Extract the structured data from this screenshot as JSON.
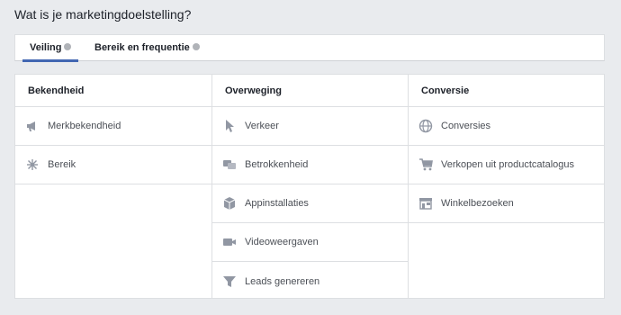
{
  "page": {
    "title": "Wat is je marketingdoelstelling?"
  },
  "tabs": [
    {
      "label": "Veiling",
      "active": true
    },
    {
      "label": "Bereik en frequentie",
      "active": false
    }
  ],
  "columns": [
    {
      "header": "Bekendheid",
      "items": [
        {
          "label": "Merkbekendheid",
          "icon": "megaphone-icon"
        },
        {
          "label": "Bereik",
          "icon": "asterisk-icon"
        }
      ]
    },
    {
      "header": "Overweging",
      "items": [
        {
          "label": "Verkeer",
          "icon": "cursor-icon"
        },
        {
          "label": "Betrokkenheid",
          "icon": "chat-bubbles-icon"
        },
        {
          "label": "Appinstallaties",
          "icon": "box-icon"
        },
        {
          "label": "Videoweergaven",
          "icon": "video-camera-icon"
        },
        {
          "label": "Leads genereren",
          "icon": "funnel-icon"
        }
      ]
    },
    {
      "header": "Conversie",
      "items": [
        {
          "label": "Conversies",
          "icon": "globe-icon"
        },
        {
          "label": "Verkopen uit productcatalogus",
          "icon": "cart-icon"
        },
        {
          "label": "Winkelbezoeken",
          "icon": "store-icon"
        }
      ]
    }
  ],
  "colors": {
    "accent": "#4267b2",
    "icon": "#9197a3",
    "border": "#dddfe2",
    "background": "#e9ebee"
  }
}
